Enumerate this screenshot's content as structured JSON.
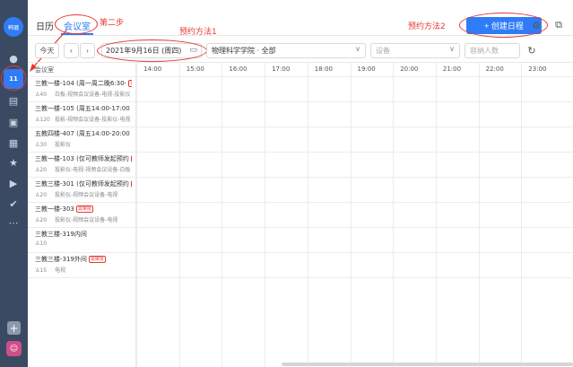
{
  "rail": {
    "avatar_text": "韩璐",
    "calendar_day": "11",
    "plus_icon": "plus-icon",
    "bot_icon": "bot-icon"
  },
  "tabs": [
    {
      "label": "日历"
    },
    {
      "label": "会议室",
      "active": true
    }
  ],
  "annotations": {
    "step2": "第二步",
    "method1": "预约方法1",
    "method2": "预约方法2"
  },
  "header": {
    "create_button": "+ 创建日程"
  },
  "toolbar": {
    "today": "今天",
    "date": "2021年9月16日 (周四)",
    "location": "物理科学学院 · 全部",
    "equipment_placeholder": "设备",
    "capacity_placeholder": "容纳人数"
  },
  "grid": {
    "room_header": "会议室",
    "times": [
      "14:00",
      "15:00",
      "16:00",
      "17:00",
      "18:00",
      "19:00",
      "20:00",
      "21:00",
      "22:00",
      "23:00"
    ],
    "badge_text": "需审批",
    "rooms": [
      {
        "name": "三教一楼-104 (周一周二晚6:30-",
        "badge": true,
        "capacity": "40",
        "equipment": "白板-视频会议设备-电视-投影仪"
      },
      {
        "name": "三教一楼-105 (周五14:00-17:00",
        "badge": true,
        "capacity": "120",
        "equipment": "投影-视频会议设备-投影仪-电视"
      },
      {
        "name": "五教四楼-407 (周五14:00-20:00",
        "badge": true,
        "capacity": "30",
        "equipment": "投影仪"
      },
      {
        "name": "三教一楼-103 (仅可教师发起预约",
        "badge": true,
        "capacity": "20",
        "equipment": "投影仪-电视-视频会议设备-白板"
      },
      {
        "name": "三教三楼-301 (仅可教师发起预约",
        "badge": true,
        "capacity": "20",
        "equipment": "投影仪-视频会议设备-电视"
      },
      {
        "name": "三教一楼-303",
        "badge": true,
        "capacity": "20",
        "equipment": "投影仪-视频会议设备-电视"
      },
      {
        "name": "三教三楼-319内间",
        "badge": false,
        "capacity": "10",
        "equipment": ""
      },
      {
        "name": "三教三楼-319外间",
        "badge": true,
        "capacity": "15",
        "equipment": "电视"
      }
    ]
  },
  "colors": {
    "accent": "#2f7cf6",
    "annotation": "#e53935",
    "rail": "#3b4a63"
  }
}
